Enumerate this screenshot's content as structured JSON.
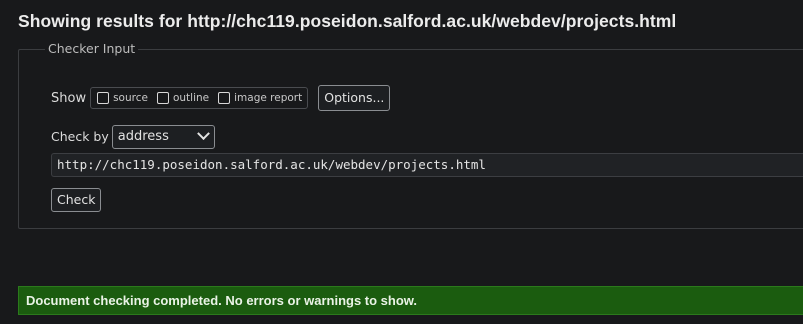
{
  "page": {
    "title": "Showing results for http://chc119.poseidon.salford.ac.uk/webdev/projects.html"
  },
  "checker": {
    "legend": "Checker Input",
    "show_label": "Show",
    "checkboxes": [
      {
        "label": "source",
        "checked": false
      },
      {
        "label": "outline",
        "checked": false
      },
      {
        "label": "image report",
        "checked": false
      }
    ],
    "options_button": "Options...",
    "check_by_label": "Check by",
    "check_by_value": "address",
    "url_value": "http://chc119.poseidon.salford.ac.uk/webdev/projects.html",
    "check_button": "Check"
  },
  "status": {
    "message": "Document checking completed. No errors or warnings to show.",
    "color": "#1b5c0f"
  }
}
